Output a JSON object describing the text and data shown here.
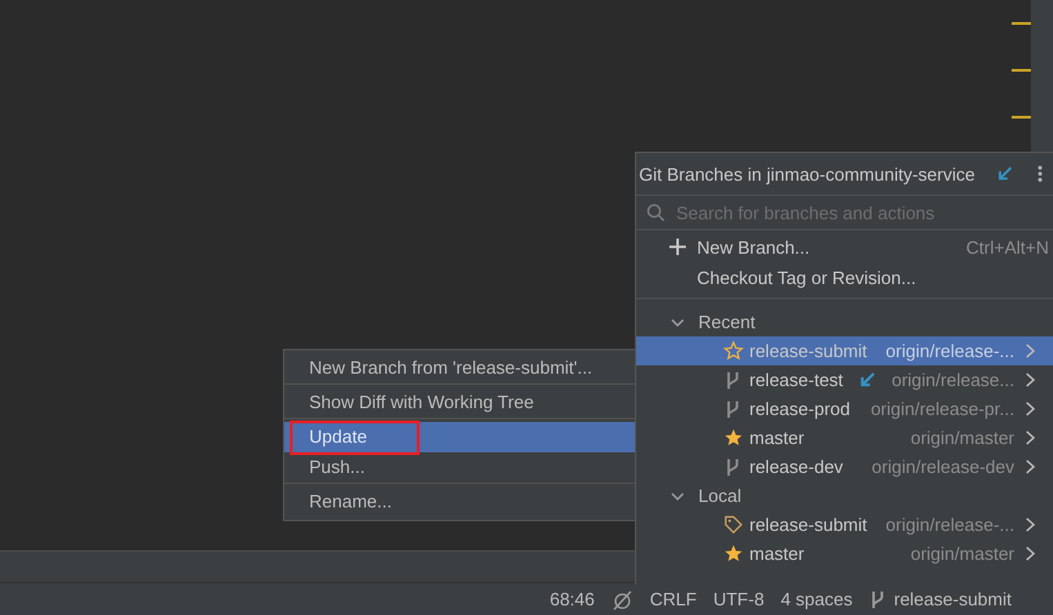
{
  "branches_popup": {
    "title": "Git Branches in jinmao-community-service",
    "search": {
      "placeholder": "Search for branches and actions"
    },
    "actions": [
      {
        "kind": "add",
        "label": "New Branch...",
        "shortcut": "Ctrl+Alt+N"
      },
      {
        "kind": "plain",
        "label": "Checkout Tag or Revision..."
      }
    ],
    "groups": [
      {
        "label": "Recent",
        "expanded": true,
        "branches": [
          {
            "kind": "current",
            "name": "release-submit",
            "remote": "origin/release-...",
            "selected": true,
            "incoming": false
          },
          {
            "kind": "branch",
            "name": "release-test",
            "remote": "origin/release...",
            "selected": false,
            "incoming": true
          },
          {
            "kind": "branch",
            "name": "release-prod",
            "remote": "origin/release-pr...",
            "selected": false,
            "incoming": false
          },
          {
            "kind": "favorite",
            "name": "master",
            "remote": "origin/master",
            "selected": false,
            "incoming": false
          },
          {
            "kind": "branch",
            "name": "release-dev",
            "remote": "origin/release-dev",
            "selected": false,
            "incoming": false
          }
        ]
      },
      {
        "label": "Local",
        "expanded": true,
        "branches": [
          {
            "kind": "tag",
            "name": "release-submit",
            "remote": "origin/release-...",
            "selected": false,
            "incoming": false
          },
          {
            "kind": "favorite",
            "name": "master",
            "remote": "origin/master",
            "selected": false,
            "incoming": false
          }
        ]
      }
    ]
  },
  "context_menu": {
    "items": [
      {
        "label": "New Branch from 'release-submit'...",
        "selected": false,
        "separator_after": true,
        "highlighted": false
      },
      {
        "label": "Show Diff with Working Tree",
        "selected": false,
        "separator_after": true,
        "highlighted": false
      },
      {
        "label": "Update",
        "selected": true,
        "separator_after": false,
        "highlighted": true
      },
      {
        "label": "Push...",
        "selected": false,
        "separator_after": true,
        "highlighted": false
      },
      {
        "label": "Rename...",
        "selected": false,
        "separator_after": false,
        "highlighted": false
      }
    ]
  },
  "status_bar": {
    "position": "68:46",
    "line_separator": "CRLF",
    "encoding": "UTF-8",
    "indent": "4 spaces",
    "branch": "release-submit"
  }
}
